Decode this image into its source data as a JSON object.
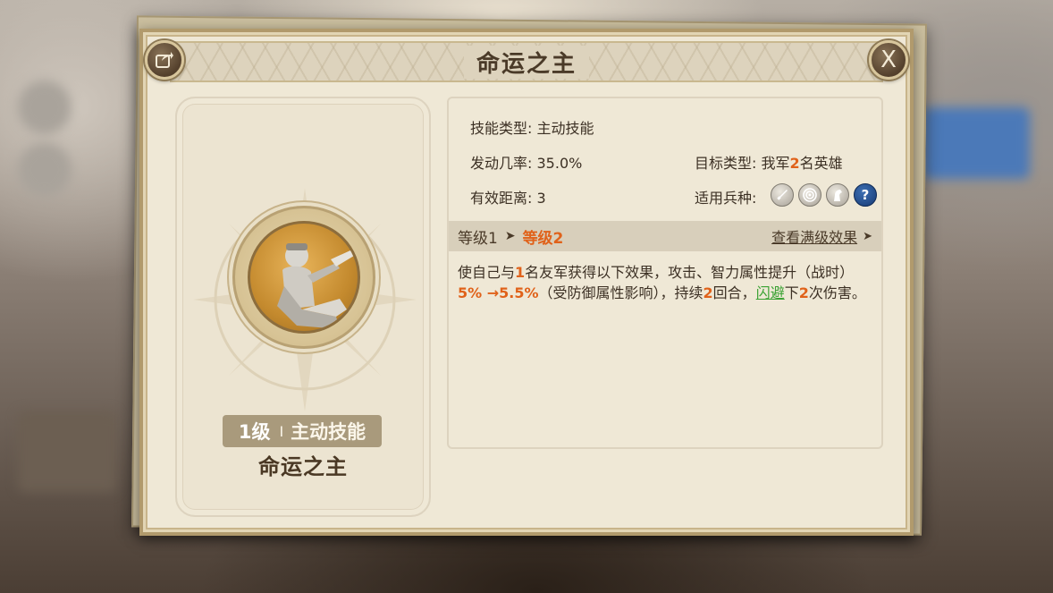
{
  "dialog": {
    "title": "命运之主"
  },
  "skill_card": {
    "level_num": "1级",
    "separator": "I",
    "level_type": "主动技能",
    "name": "命运之主"
  },
  "info": {
    "skill_type_label": "技能类型:",
    "skill_type_value": "主动技能",
    "trigger_rate_label": "发动几率:",
    "trigger_rate_value": "35.0%",
    "range_label": "有效距离:",
    "range_value": "3",
    "target_label": "目标类型:",
    "target_prefix": "我军",
    "target_count": "2",
    "target_suffix": "名英雄",
    "troop_label": "适用兵种:",
    "troop_icons": [
      "sword-icon",
      "target-icon",
      "horse-icon",
      "question-icon"
    ],
    "troop_question_glyph": "?"
  },
  "level_band": {
    "current": "等级1",
    "arrow": "➤",
    "next": "等级2",
    "view_max": "查看满级效果",
    "view_max_arrow": "➤"
  },
  "description": {
    "p1": "使自己与",
    "n1": "1",
    "p2": "名友军获得以下效果，攻击、智力属性提升（战时）",
    "v": "5% →5.5%",
    "p3": "（受防御属性影响），持续",
    "n2": "2",
    "p4": "回合，",
    "link": "闪避",
    "p5": "下",
    "n3": "2",
    "p6": "次伤害。"
  },
  "colors": {
    "accent_orange": "#e0621a",
    "link_green": "#3aa233",
    "panel_bg": "#efe8d6",
    "text_brown": "#4a3a28"
  },
  "close_glyph": "X"
}
